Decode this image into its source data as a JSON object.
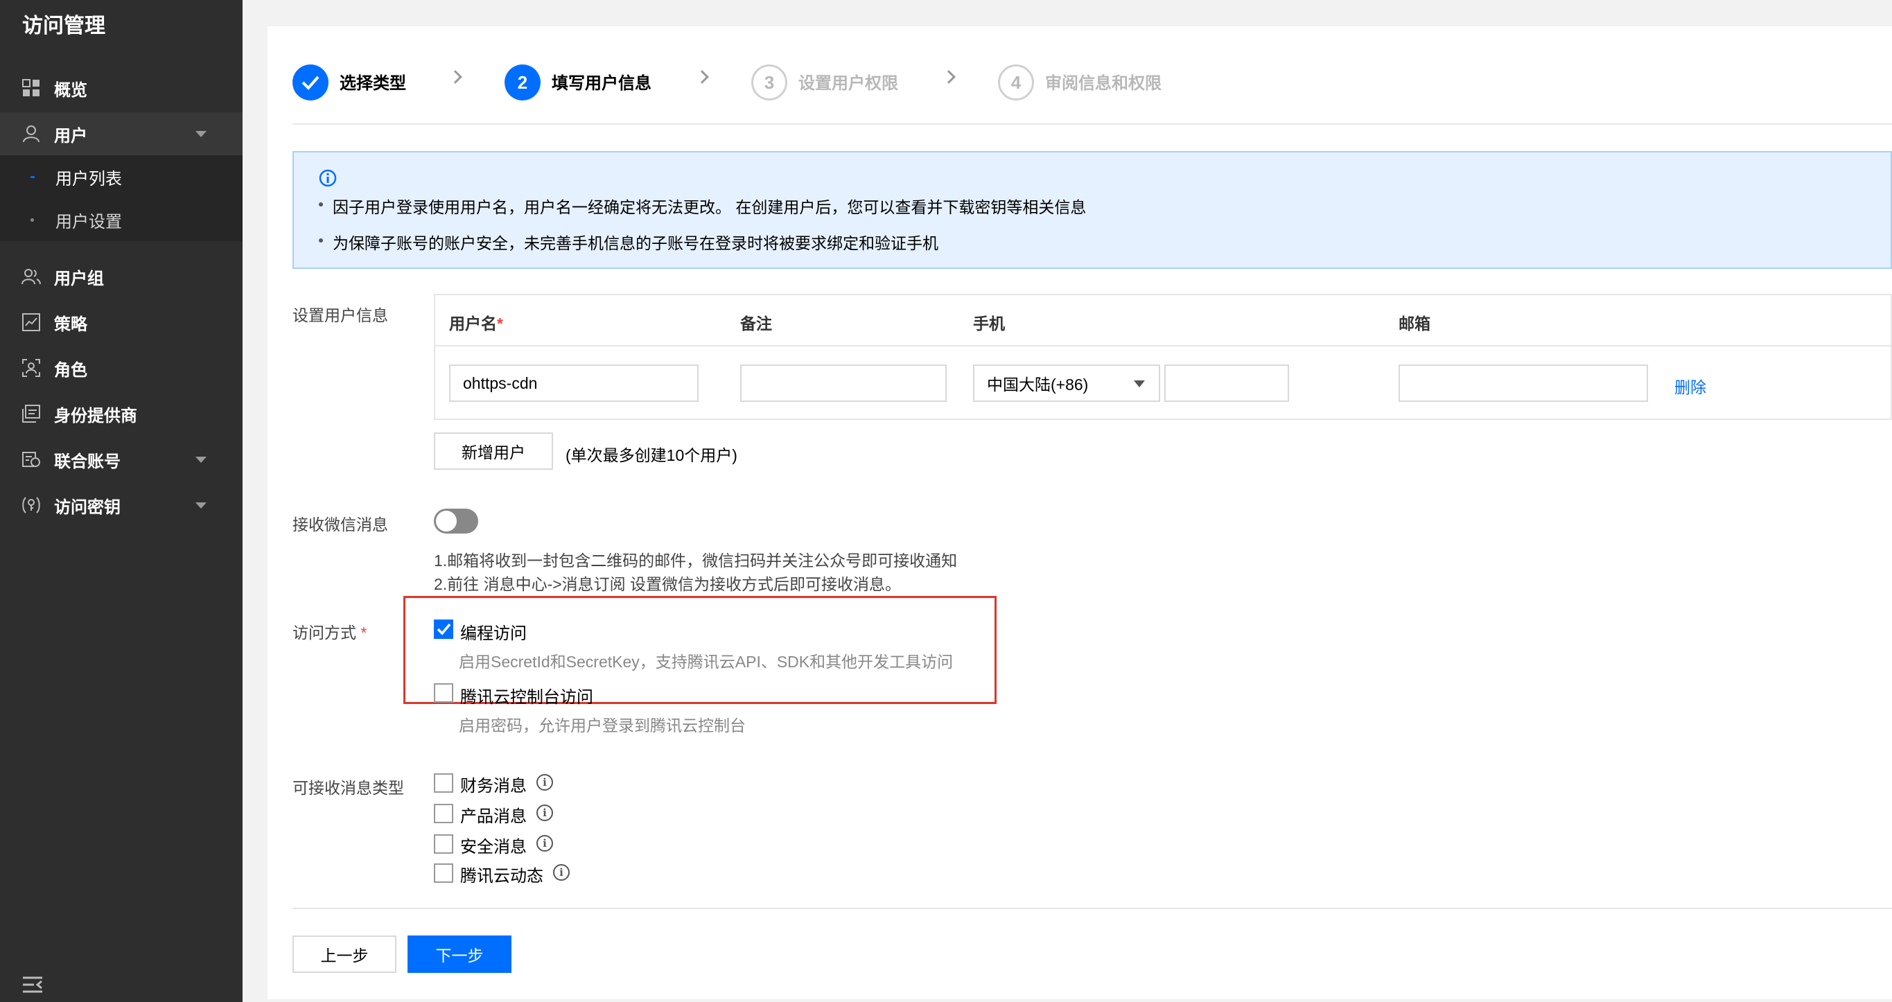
{
  "sidebar": {
    "title": "访问管理",
    "items": [
      {
        "label": "概览",
        "icon": "grid-icon"
      },
      {
        "label": "用户",
        "icon": "user-icon",
        "expanded": true
      },
      {
        "label": "用户组",
        "icon": "user-group-icon"
      },
      {
        "label": "策略",
        "icon": "policy-icon"
      },
      {
        "label": "角色",
        "icon": "role-icon"
      },
      {
        "label": "身份提供商",
        "icon": "identity-provider-icon"
      },
      {
        "label": "联合账号",
        "icon": "federated-account-icon"
      },
      {
        "label": "访问密钥",
        "icon": "key-icon"
      }
    ],
    "sub_items": [
      {
        "label": "用户列表",
        "active": true
      },
      {
        "label": "用户设置",
        "active": false
      }
    ]
  },
  "steps": [
    {
      "number": "",
      "label": "选择类型",
      "state": "done"
    },
    {
      "number": "2",
      "label": "填写用户信息",
      "state": "current"
    },
    {
      "number": "3",
      "label": "设置用户权限",
      "state": "todo"
    },
    {
      "number": "4",
      "label": "审阅信息和权限",
      "state": "todo"
    }
  ],
  "notice": {
    "lines": [
      "因子用户登录使用用户名，用户名一经确定将无法更改。 在创建用户后，您可以查看并下载密钥等相关信息",
      "为保障子账号的账户安全，未完善手机信息的子账号在登录时将被要求绑定和验证手机"
    ]
  },
  "user_info": {
    "label": "设置用户信息",
    "columns": [
      "用户名",
      "备注",
      "手机",
      "邮箱"
    ],
    "required_mark": "*",
    "row": {
      "username": "ohttps-cdn",
      "remark": "",
      "phone_region": "中国大陆(+86)",
      "phone": "",
      "email": "",
      "delete_label": "删除"
    },
    "add_button": "新增用户",
    "add_hint": "(单次最多创建10个用户)"
  },
  "wechat": {
    "label": "接收微信消息",
    "enabled": false,
    "notes": [
      "1.邮箱将收到一封包含二维码的邮件，微信扫码并关注公众号即可接收通知",
      "2.前往 消息中心->消息订阅 设置微信为接收方式后即可接收消息。"
    ]
  },
  "access": {
    "label": "访问方式",
    "required_mark": "*",
    "options": [
      {
        "label": "编程访问",
        "desc": "启用SecretId和SecretKey，支持腾讯云API、SDK和其他开发工具访问",
        "checked": true
      },
      {
        "label": "腾讯云控制台访问",
        "desc": "启用密码，允许用户登录到腾讯云控制台",
        "checked": false
      }
    ]
  },
  "message_types": {
    "label": "可接收消息类型",
    "options": [
      {
        "label": "财务消息",
        "checked": false
      },
      {
        "label": "产品消息",
        "checked": false
      },
      {
        "label": "安全消息",
        "checked": false
      },
      {
        "label": "腾讯云动态",
        "checked": false
      }
    ]
  },
  "footer": {
    "prev": "上一步",
    "next": "下一步"
  },
  "colors": {
    "accent": "#006eff",
    "sidebar_bg": "#2e2e2e",
    "highlight_border": "#e0352b"
  }
}
